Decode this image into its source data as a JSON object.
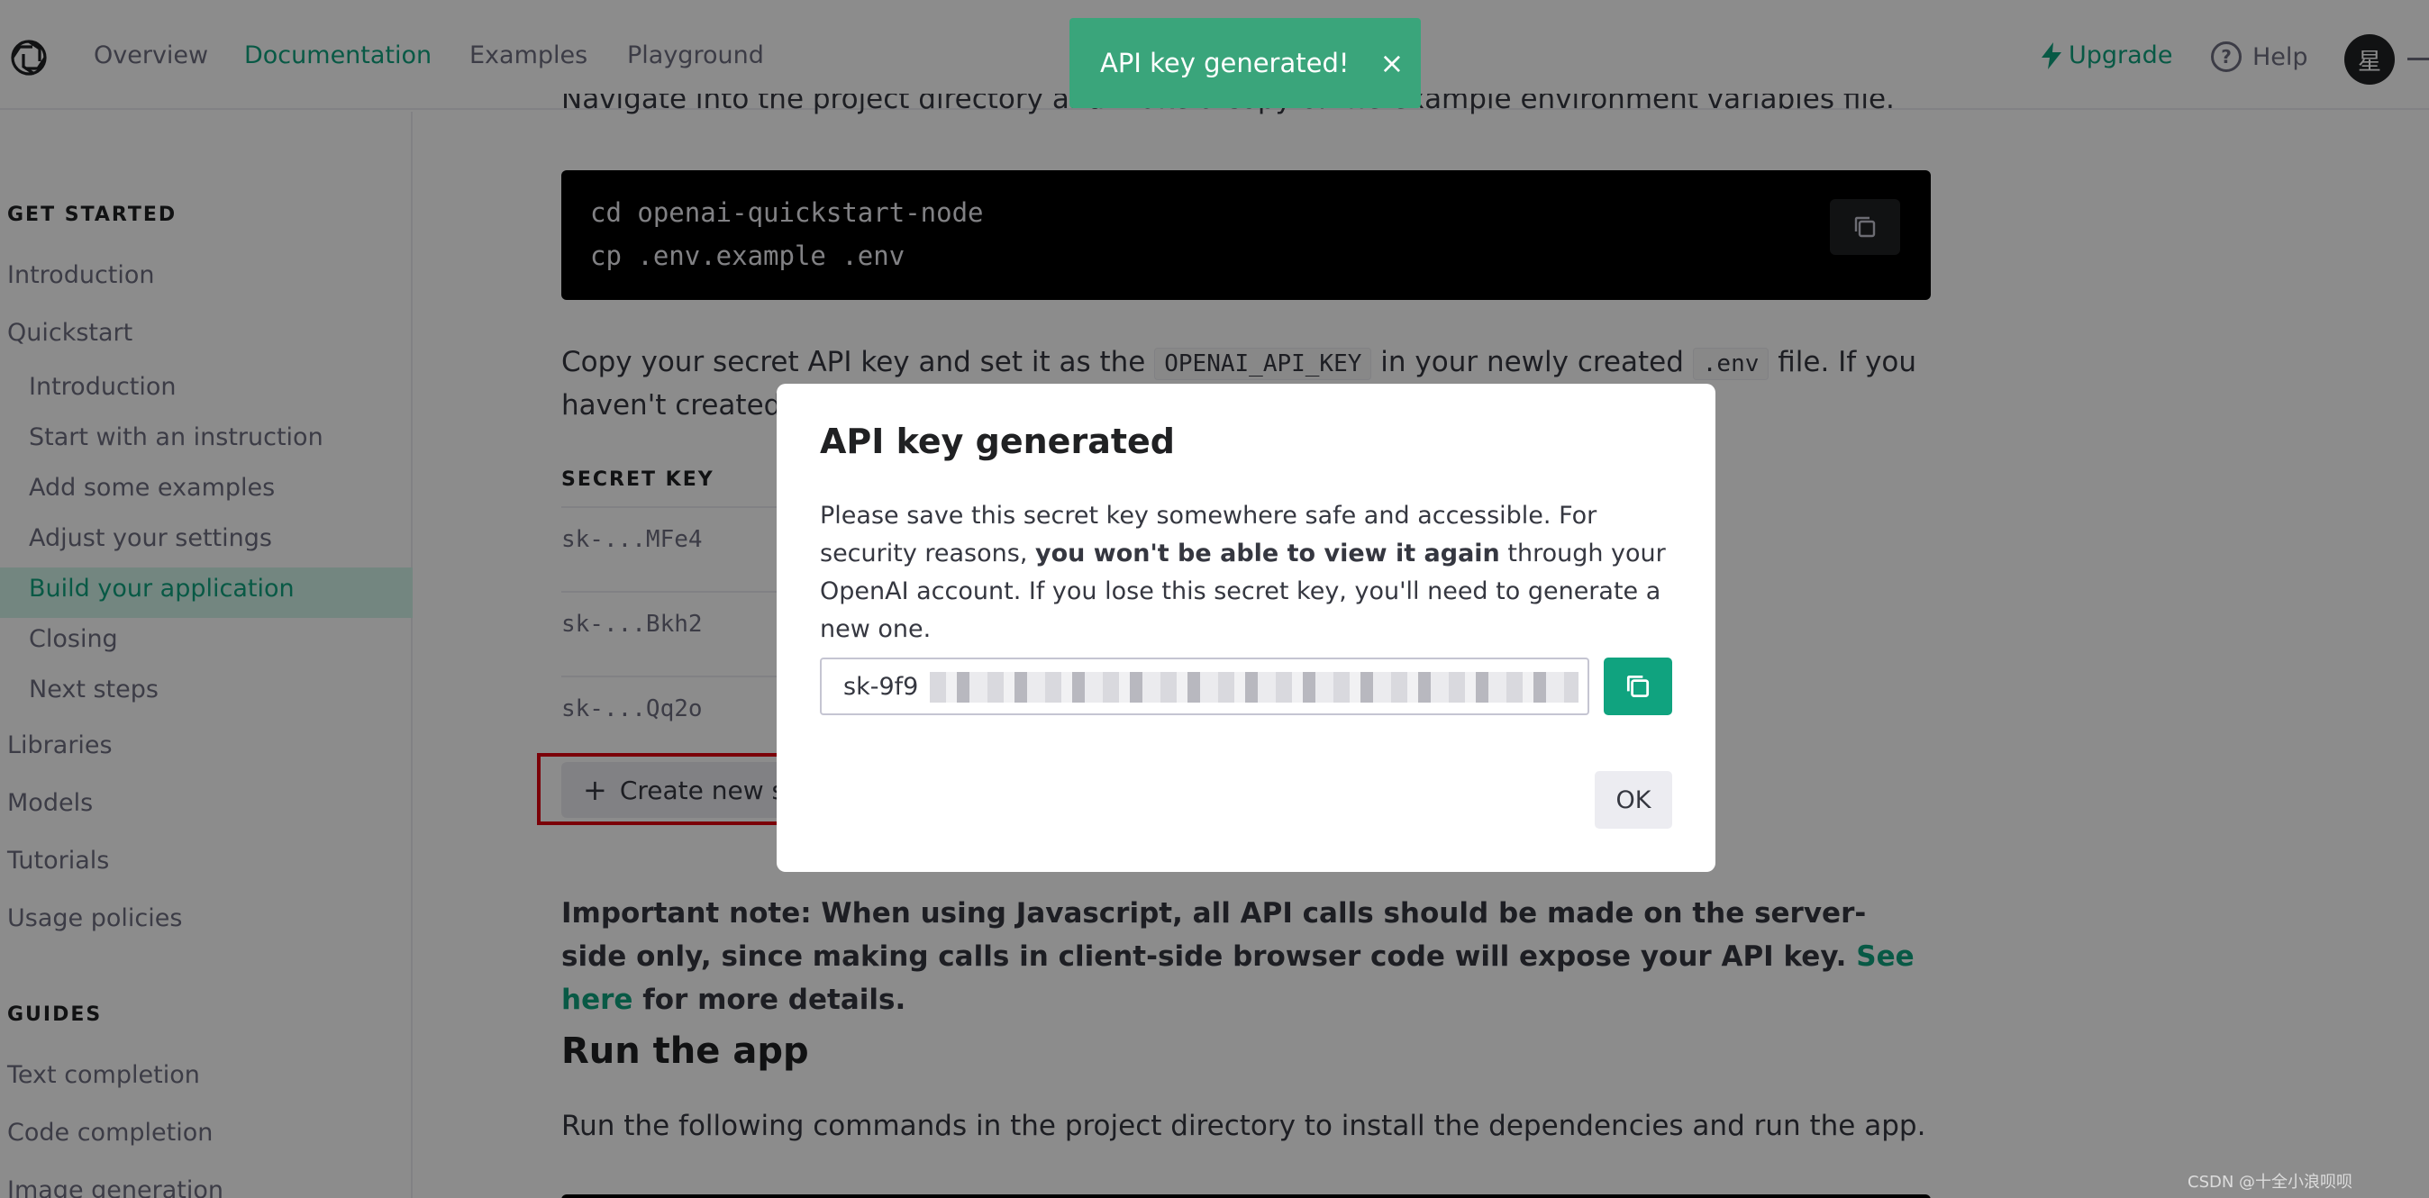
{
  "nav": {
    "links": [
      "Overview",
      "Documentation",
      "Examples",
      "Playground"
    ],
    "upgrade": "Upgrade",
    "help": "Help",
    "avatar": "星"
  },
  "sidebar": {
    "heading_get_started": "GET STARTED",
    "introduction": "Introduction",
    "quickstart": "Quickstart",
    "quickstart_items": [
      "Introduction",
      "Start with an instruction",
      "Add some examples",
      "Adjust your settings",
      "Build your application",
      "Closing",
      "Next steps"
    ],
    "libraries": "Libraries",
    "models": "Models",
    "tutorials": "Tutorials",
    "usage_policies": "Usage policies",
    "heading_guides": "GUIDES",
    "guides": [
      "Text completion",
      "Code completion",
      "Image generation"
    ]
  },
  "main": {
    "partial_text": "Navigate into the project directory and make a copy of the example environment variables file.",
    "code_lines": [
      "cd openai-quickstart-node",
      "cp .env.example .env"
    ],
    "copy_para_1": "Copy your secret API key and set it as the",
    "code_openai_key": "OPENAI_API_KEY",
    "copy_para_2": "in your newly created",
    "code_env": ".env",
    "copy_para_3": "file. If you",
    "copy_para_line2": "haven't created",
    "secret_key_heading": "SECRET KEY",
    "keys": [
      "sk-...MFe4",
      "sk-...Bkh2",
      "sk-...Qq2o"
    ],
    "create_button": "Create new secret key",
    "important_1": "Important note: When using Javascript, all API calls should be made on the server-side only, since making calls in client-side browser code will expose your API key.",
    "important_link": "See here",
    "important_2": "for more details.",
    "run_title": "Run the app",
    "run_para": "Run the following commands in the project directory to install the dependencies and run the app."
  },
  "toast": {
    "text": "API key generated!",
    "close": "×"
  },
  "modal": {
    "title": "API key generated",
    "body_1": "Please save this secret key somewhere safe and accessible. For security reasons,",
    "body_bold": "you won't be able to view it again",
    "body_2": "through your OpenAI account. If you lose this secret key, you'll need to generate a new one.",
    "key_value": "sk-9f9",
    "ok": "OK"
  },
  "watermark": "CSDN @十全小浪呗呗"
}
